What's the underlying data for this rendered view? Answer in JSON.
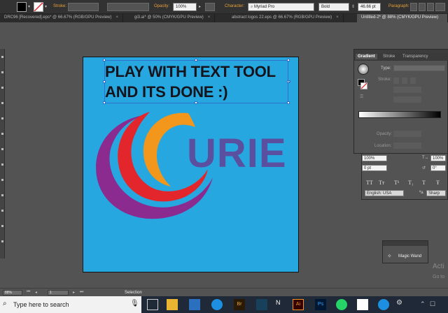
{
  "control_bar": {
    "stroke_label": "Stroke:",
    "opacity_label": "Opacity:",
    "opacity_value": "100%",
    "character_label": "Character:",
    "font_family": "Myriad Pro",
    "font_style": "Bold",
    "font_size": "46.66 pt",
    "paragraph_label": "Paragraph:"
  },
  "doc_tabs": [
    {
      "label": "DRC96 [Recovered].eps* @ 66.67% (RGB/GPU Preview)",
      "active": false
    },
    {
      "label": "gi3.ai* @ 50% (CMYK/GPU Preview)",
      "active": false
    },
    {
      "label": "abstract logos 22.eps @ 66.67% (RGB/GPU Preview)",
      "active": false
    },
    {
      "label": "Untitled-2* @ 88% (CMYK/GPU Preview)",
      "active": true
    }
  ],
  "artboard": {
    "headline_line1": "PLAY WITH TEXT TOOL",
    "headline_line2": "AND ITS DONE :)",
    "brand_text": "URIE",
    "colors": {
      "background": "#26a7e0",
      "purple": "#8b2a8f",
      "red": "#e3262b",
      "orange": "#f3961c",
      "brand": "#5b4fa0"
    }
  },
  "gradient_panel": {
    "tabs": [
      "Gradient",
      "Stroke",
      "Transparency"
    ],
    "type_label": "Type:",
    "stroke_label": "Stroke:",
    "opacity_label": "Opacity:",
    "location_label": "Location:"
  },
  "character_panel": {
    "scale_v": "100%",
    "scale_h": "100%",
    "baseline": "0 pt",
    "rotation": "0°",
    "language": "English: USA",
    "anti_alias": "Sharp",
    "type_buttons": [
      "TT",
      "Tт",
      "T¹",
      "T₁",
      "T",
      "Ŧ"
    ]
  },
  "magic_wand": {
    "label": "Magic Wand"
  },
  "watermark": {
    "line1": "Acti",
    "line2": "Go to"
  },
  "status_bar": {
    "zoom": "88%",
    "page": "1",
    "tool": "Selection"
  },
  "taskbar": {
    "search_placeholder": "Type here to search",
    "icons": [
      "task-view",
      "file-explorer",
      "store",
      "edge",
      "bridge",
      "network",
      "illustrator",
      "photoshop",
      "skype",
      "whatsapp",
      "mail",
      "edge-2",
      "settings"
    ]
  }
}
